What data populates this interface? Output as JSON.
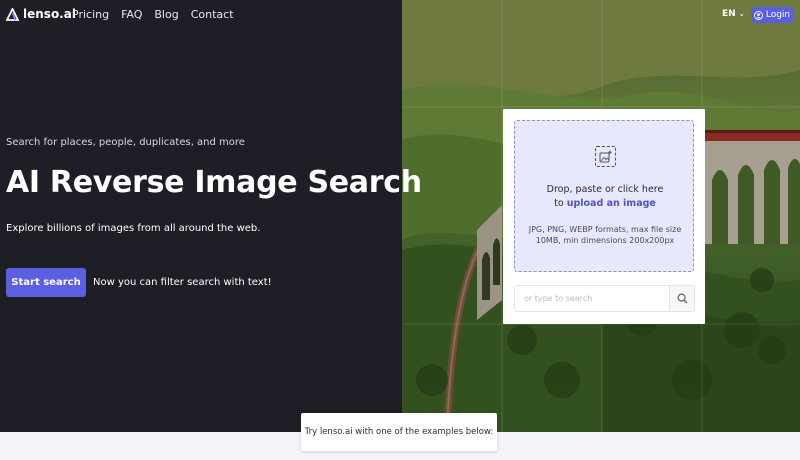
{
  "nav": {
    "logo": "lenso.ai",
    "links": [
      "Pricing",
      "FAQ",
      "Blog",
      "Contact"
    ],
    "language": "EN",
    "login": "Login"
  },
  "hero": {
    "eyebrow": "Search for places, people, duplicates, and more",
    "title": "AI Reverse Image Search",
    "subtitle": "Explore billions of images from all around the web.",
    "start_button": "Start search",
    "filter_note": "Now you can filter search with text!"
  },
  "upload": {
    "line1": "Drop, paste or click here",
    "line2_prefix": "to ",
    "line2_link": "upload an image",
    "info": "JPG, PNG, WEBP formats, max file size 10MB, min dimensions 200x200px",
    "search_placeholder": "or type to search"
  },
  "examples": {
    "text": "Try lenso.ai with one of the examples below:"
  },
  "colors": {
    "accent": "#5b5fe0",
    "dark_bg": "#1d1e26",
    "dropzone_bg": "#e8e8fb"
  }
}
